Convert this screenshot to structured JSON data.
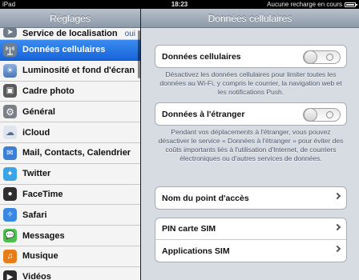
{
  "status_bar": {
    "device": "iPad",
    "time": "18:23",
    "charging": "Aucune recharge en cours"
  },
  "sidebar": {
    "title": "Réglages",
    "items": [
      {
        "label": "Service de localisation",
        "value": "oui",
        "icon": "location-icon",
        "color": "#6e7c8a"
      },
      {
        "label": "Données cellulaires",
        "icon": "cellular-antenna-icon",
        "color": "#6d7f93",
        "selected": true
      },
      {
        "label": "Luminosité et fond d'écran",
        "icon": "brightness-icon",
        "color": "#5f84b8"
      },
      {
        "label": "Cadre photo",
        "icon": "picture-frame-icon",
        "color": "#5a5a5a"
      },
      {
        "label": "Général",
        "icon": "gear-icon",
        "color": "#7b7f86"
      },
      {
        "label": "iCloud",
        "icon": "cloud-icon",
        "color": "#dfe5ee"
      },
      {
        "label": "Mail, Contacts, Calendrier",
        "icon": "mail-icon",
        "color": "#3b7fd6"
      },
      {
        "label": "Twitter",
        "icon": "twitter-bird-icon",
        "color": "#39a4e6"
      },
      {
        "label": "FaceTime",
        "icon": "video-camera-icon",
        "color": "#2f2f2f"
      },
      {
        "label": "Safari",
        "icon": "compass-icon",
        "color": "#3b88e2"
      },
      {
        "label": "Messages",
        "icon": "speech-bubble-icon",
        "color": "#4cc04c"
      },
      {
        "label": "Musique",
        "icon": "music-note-icon",
        "color": "#e67d19"
      },
      {
        "label": "Vidéos",
        "icon": "film-icon",
        "color": "#2b2b2b"
      }
    ]
  },
  "main": {
    "title": "Données cellulaires",
    "cellular_toggle": {
      "label": "Données cellulaires",
      "on": false
    },
    "cellular_note": "Désactivez les données cellulaires pour limiter toutes les données au Wi-Fi, y compris le courrier, la navigation web et les notifications Push.",
    "roaming_toggle": {
      "label": "Données à l'étranger",
      "on": false
    },
    "roaming_note": "Pendant vos déplacements à l'étranger, vous pouvez désactiver le service « Données à l'étranger » pour éviter des coûts importants liés à l'utilisation d'Internet, de courriers électroniques ou d'autres services de données.",
    "apn_label": "Nom du point d'accès",
    "sim_pin_label": "PIN carte SIM",
    "sim_apps_label": "Applications SIM"
  }
}
